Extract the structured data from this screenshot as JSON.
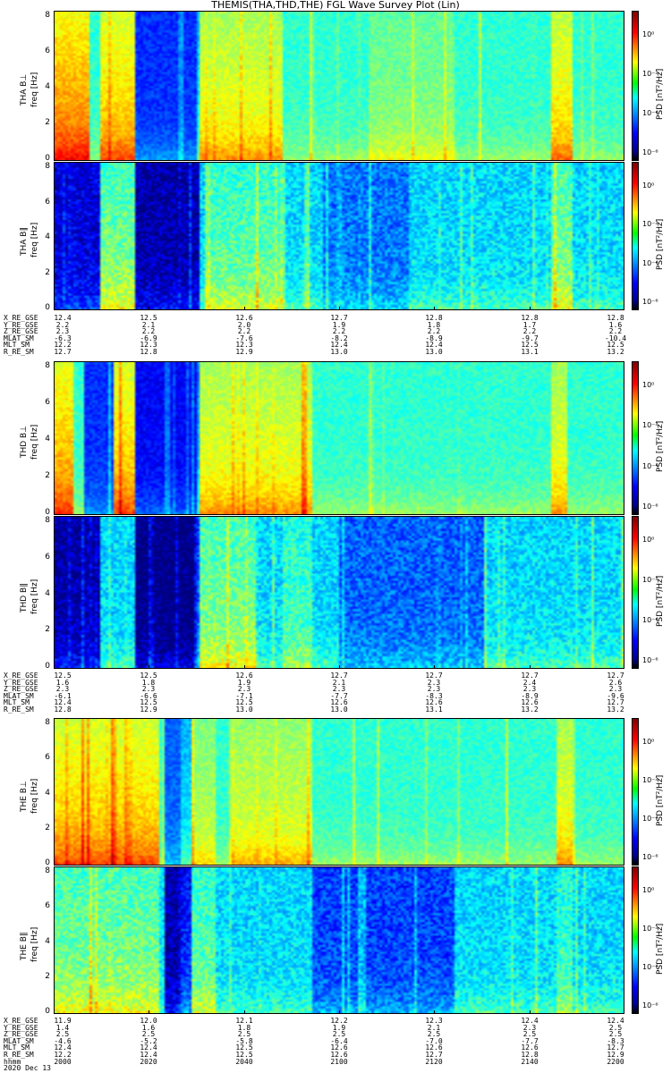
{
  "title": "THEMIS(THA,THD,THE) FGL Wave Survey Plot (Lin)",
  "colorbar": {
    "label": "PSD [nT²/Hz]",
    "tick_sets": [
      [
        "10⁰",
        "10⁻²",
        "10⁻⁴",
        "10⁻⁶"
      ],
      [
        "10⁰",
        "10⁻²",
        "10⁻⁴",
        "10⁻⁶"
      ],
      [
        "10⁰",
        "10⁻²",
        "10⁻⁴",
        "10⁻⁶"
      ],
      [
        "10⁰",
        "10⁻²",
        "10⁻⁴",
        "10⁻⁶"
      ],
      [
        "10⁰",
        "10⁻²",
        "10⁻⁴",
        "10⁻⁶"
      ],
      [
        "10⁰",
        "10⁻²",
        "10⁻⁴",
        "10⁻⁶"
      ]
    ]
  },
  "yticks": [
    "0",
    "2",
    "4",
    "6",
    "8"
  ],
  "panels": [
    {
      "probe": "THA",
      "comp": "B⊥",
      "ylabel": "THA B⊥",
      "ysub": "freq [Hz]"
    },
    {
      "probe": "THA",
      "comp": "B∥",
      "ylabel": "THA B∥",
      "ysub": "freq [Hz]"
    },
    {
      "probe": "THD",
      "comp": "B⊥",
      "ylabel": "THD B⊥",
      "ysub": "freq [Hz]"
    },
    {
      "probe": "THD",
      "comp": "B∥",
      "ylabel": "THD B∥",
      "ysub": "freq [Hz]"
    },
    {
      "probe": "THE",
      "comp": "B⊥",
      "ylabel": "THE B⊥",
      "ysub": "freq [Hz]"
    },
    {
      "probe": "THE",
      "comp": "B∥",
      "ylabel": "THE B∥",
      "ysub": "freq [Hz]"
    }
  ],
  "ephemeris": [
    {
      "names": [
        "X_RE_GSE",
        "Y_RE_GSE",
        "Z_RE_GSE",
        "MLAT_SM",
        "MLT_SM",
        "R_RE_SM"
      ],
      "rows": [
        [
          "12.4",
          "12.5",
          "12.6",
          "12.7",
          "12.8",
          "12.8",
          "12.8"
        ],
        [
          "2.2",
          "2.1",
          "2.0",
          "1.9",
          "1.8",
          "1.7",
          "1.6"
        ],
        [
          "2.3",
          "2.2",
          "2.2",
          "2.2",
          "2.2",
          "2.2",
          "2.2"
        ],
        [
          "-6.3",
          "-6.9",
          "-7.6",
          "-8.2",
          "-8.9",
          "-9.7",
          "-10.4"
        ],
        [
          "12.2",
          "12.3",
          "12.3",
          "12.4",
          "12.4",
          "12.5",
          "12.5"
        ],
        [
          "12.7",
          "12.8",
          "12.9",
          "13.0",
          "13.0",
          "13.1",
          "13.2"
        ]
      ]
    },
    {
      "names": [
        "X_RE_GSE",
        "Y_RE_GSE",
        "Z_RE_GSE",
        "MLAT_SM",
        "MLT_SM",
        "R_RE_SM"
      ],
      "rows": [
        [
          "12.5",
          "12.5",
          "12.6",
          "12.7",
          "12.7",
          "12.7",
          "12.7"
        ],
        [
          "1.6",
          "1.8",
          "1.9",
          "2.1",
          "2.3",
          "2.4",
          "2.6"
        ],
        [
          "2.3",
          "2.3",
          "2.3",
          "2.3",
          "2.3",
          "2.3",
          "2.3"
        ],
        [
          "-6.1",
          "-6.6",
          "-7.1",
          "-7.7",
          "-8.3",
          "-8.9",
          "-9.6"
        ],
        [
          "12.4",
          "12.5",
          "12.5",
          "12.6",
          "12.6",
          "12.6",
          "12.7"
        ],
        [
          "12.8",
          "12.9",
          "13.0",
          "13.0",
          "13.1",
          "13.2",
          "13.2"
        ]
      ]
    },
    {
      "names": [
        "X_RE_GSE",
        "Y_RE_GSE",
        "Z_RE_GSE",
        "MLAT_SM",
        "MLT_SM",
        "R_RE_SM",
        "hhmm",
        "2020 Dec 13"
      ],
      "rows": [
        [
          "11.9",
          "12.0",
          "12.1",
          "12.2",
          "12.3",
          "12.4",
          "12.4"
        ],
        [
          "1.4",
          "1.6",
          "1.8",
          "1.9",
          "2.1",
          "2.3",
          "2.5"
        ],
        [
          "2.5",
          "2.5",
          "2.5",
          "2.5",
          "2.5",
          "2.5",
          "2.5"
        ],
        [
          "-4.6",
          "-5.2",
          "-5.8",
          "-6.4",
          "-7.0",
          "-7.7",
          "-8.3"
        ],
        [
          "12.4",
          "12.4",
          "12.5",
          "12.6",
          "12.6",
          "12.6",
          "12.7"
        ],
        [
          "12.2",
          "12.4",
          "12.5",
          "12.6",
          "12.7",
          "12.8",
          "12.9"
        ],
        [
          "2000",
          "2020",
          "2040",
          "2100",
          "2120",
          "2140",
          "2200"
        ]
      ]
    }
  ],
  "chart_data": [
    {
      "type": "heatmap",
      "title": "THEMIS(THA,THD,THE) FGL Wave Survey Plot (Lin)",
      "panel": "THA B⊥",
      "xlabel": "hhmm",
      "x": [
        "2000",
        "2020",
        "2040",
        "2100",
        "2120",
        "2140",
        "2200"
      ],
      "ylabel": "freq [Hz]",
      "ylim": [
        0,
        8
      ],
      "colorbar_label": "PSD [nT²/Hz]",
      "color_scale": "log",
      "color_range": [
        1e-07,
        10
      ]
    },
    {
      "type": "heatmap",
      "panel": "THA B∥",
      "xlabel": "hhmm",
      "x": [
        "2000",
        "2020",
        "2040",
        "2100",
        "2120",
        "2140",
        "2200"
      ],
      "ylabel": "freq [Hz]",
      "ylim": [
        0,
        8
      ],
      "colorbar_label": "PSD [nT²/Hz]",
      "color_scale": "log",
      "color_range": [
        1e-07,
        10
      ]
    },
    {
      "type": "heatmap",
      "panel": "THD B⊥",
      "xlabel": "hhmm",
      "x": [
        "2000",
        "2020",
        "2040",
        "2100",
        "2120",
        "2140",
        "2200"
      ],
      "ylabel": "freq [Hz]",
      "ylim": [
        0,
        8
      ],
      "colorbar_label": "PSD [nT²/Hz]",
      "color_scale": "log",
      "color_range": [
        1e-07,
        10
      ]
    },
    {
      "type": "heatmap",
      "panel": "THD B∥",
      "xlabel": "hhmm",
      "x": [
        "2000",
        "2020",
        "2040",
        "2100",
        "2120",
        "2140",
        "2200"
      ],
      "ylabel": "freq [Hz]",
      "ylim": [
        0,
        8
      ],
      "colorbar_label": "PSD [nT²/Hz]",
      "color_scale": "log",
      "color_range": [
        1e-07,
        10
      ]
    },
    {
      "type": "heatmap",
      "panel": "THE B⊥",
      "xlabel": "hhmm",
      "x": [
        "2000",
        "2020",
        "2040",
        "2100",
        "2120",
        "2140",
        "2200"
      ],
      "ylabel": "freq [Hz]",
      "ylim": [
        0,
        8
      ],
      "colorbar_label": "PSD [nT²/Hz]",
      "color_scale": "log",
      "color_range": [
        1e-07,
        10
      ]
    },
    {
      "type": "heatmap",
      "panel": "THE B∥",
      "xlabel": "hhmm",
      "x": [
        "2000",
        "2020",
        "2040",
        "2100",
        "2120",
        "2140",
        "2200"
      ],
      "ylabel": "freq [Hz]",
      "ylim": [
        0,
        8
      ],
      "colorbar_label": "PSD [nT²/Hz]",
      "color_scale": "log",
      "color_range": [
        1e-07,
        10
      ]
    }
  ]
}
